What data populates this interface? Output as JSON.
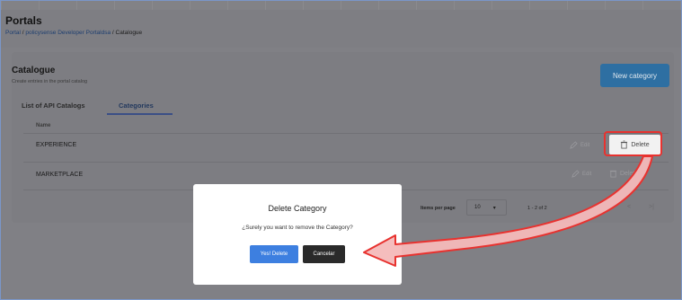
{
  "page": {
    "title": "Portals",
    "breadcrumb": {
      "part1": "Portal",
      "sep": "/",
      "part2": "policysense Developer Portaldsa",
      "part3": "Catalogue"
    }
  },
  "catalogue": {
    "title": "Catalogue",
    "subtitle": "Create entries in the portal catalog",
    "new_button": "New category",
    "tabs": [
      "List of API Catalogs",
      "Categories"
    ],
    "column_name": "Name",
    "rows": [
      {
        "name": "EXPERIENCE",
        "edit": "Edit",
        "delete": "Delete"
      },
      {
        "name": "MARKETPLACE",
        "edit": "Edit",
        "delete": "Delete"
      }
    ],
    "pagination": {
      "label": "Items per page",
      "value": "10",
      "range": "1 - 2 of 2",
      "prev": "<",
      "last": ">|"
    }
  },
  "modal": {
    "title": "Delete Category",
    "message": "¿Surely you want to remove the Category?",
    "confirm": "Yes! Delete",
    "cancel": "Cancelar"
  },
  "colors": {
    "accent": "#2e6fa2",
    "highlight": "#e8322f",
    "confirm": "#3d7fe0"
  }
}
